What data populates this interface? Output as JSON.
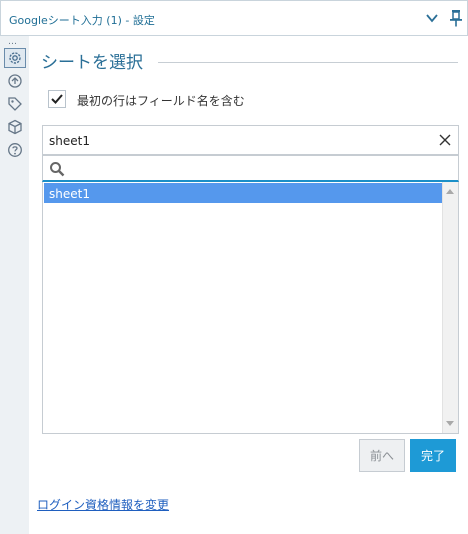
{
  "window": {
    "title": "Googleシート入力 (1) - 設定"
  },
  "rail": {
    "overflow": "…",
    "items": [
      {
        "icon": "gear-icon"
      },
      {
        "icon": "refresh-icon"
      },
      {
        "icon": "tag-icon"
      },
      {
        "icon": "cube-icon"
      },
      {
        "icon": "help-icon"
      }
    ]
  },
  "main": {
    "heading": "シートを選択",
    "checkbox": {
      "label": "最初の行はフィールド名を含む",
      "checked": true
    },
    "select": {
      "value": "sheet1"
    },
    "search": {
      "value": "",
      "icon": "search-icon"
    },
    "list": {
      "items": [
        {
          "label": "sheet1",
          "selected": true
        }
      ]
    },
    "buttons": {
      "prev": "前へ",
      "done": "完了"
    },
    "link": "ログイン資格情報を変更"
  },
  "colors": {
    "accent": "#1e9ad6",
    "selection": "#5598ed",
    "title": "#1f6e95"
  }
}
